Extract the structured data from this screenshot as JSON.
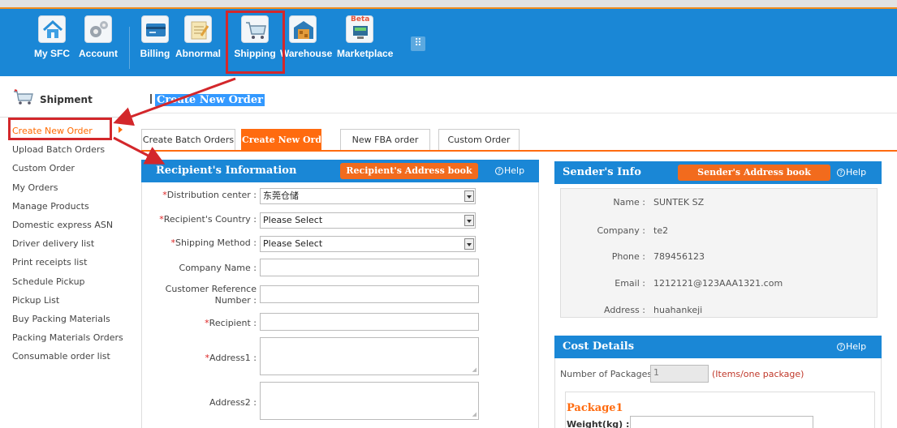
{
  "nav": {
    "items": [
      {
        "label": "My SFC",
        "icon": "home-icon"
      },
      {
        "label": "Account",
        "icon": "gears-icon"
      },
      {
        "label": "Billing",
        "icon": "credit-card-icon"
      },
      {
        "label": "Abnormal",
        "icon": "notepad-icon"
      },
      {
        "label": "Shipping",
        "icon": "cart-icon"
      },
      {
        "label": "Warehouse",
        "icon": "warehouse-icon"
      },
      {
        "label": "Marketplace",
        "icon": "monitor-icon",
        "badge": "Beta"
      }
    ]
  },
  "sidebar": {
    "title": "Shipment",
    "items": [
      "Create New Order",
      "Upload Batch Orders",
      "Custom Order",
      "My Orders",
      "Manage Products",
      "Domestic express ASN",
      "Driver delivery list",
      "Print receipts list",
      "Schedule Pickup",
      "Pickup List",
      "Buy Packing Materials",
      "Packing Materials Orders",
      "Consumable order list"
    ]
  },
  "page": {
    "title": "Create New Order"
  },
  "tabs": [
    "Create Batch Orders",
    "Create New Ord",
    "New FBA order",
    "Custom Order"
  ],
  "recipient": {
    "title": "Recipient's Information",
    "book": "Recipient's Address book",
    "help": "Help",
    "distribution_label": "Distribution center :",
    "distribution_value": "东莞仓储",
    "country_label": "Recipient's Country :",
    "country_value": "Please Select",
    "method_label": "Shipping Method :",
    "method_value": "Please Select",
    "company_label": "Company Name :",
    "ref_label_1": "Customer Reference",
    "ref_label_2": "Number :",
    "recipient_label": "Recipient :",
    "address1_label": "Address1 :",
    "address2_label": "Address2 :"
  },
  "sender": {
    "title": "Sender's Info",
    "book": "Sender's Address book",
    "help": "Help",
    "rows": [
      {
        "key": "Name :",
        "value": "SUNTEK SZ"
      },
      {
        "key": "Company :",
        "value": "te2"
      },
      {
        "key": "Phone :",
        "value": "789456123"
      },
      {
        "key": "Email :",
        "value": "1212121@123AAA1321.com"
      },
      {
        "key": "Address :",
        "value": "huahankeji"
      }
    ]
  },
  "cost": {
    "title": "Cost Details",
    "help": "Help",
    "packages_label": "Number of Packages :",
    "packages_value": "1",
    "packages_hint": "(Items/one package)",
    "package_title": "Package1",
    "weight_label": "Weight(kg) :"
  },
  "colors": {
    "brand_blue": "#1a87d6",
    "accent_orange": "#ff6b0f",
    "annotation_red": "#d3272b"
  }
}
